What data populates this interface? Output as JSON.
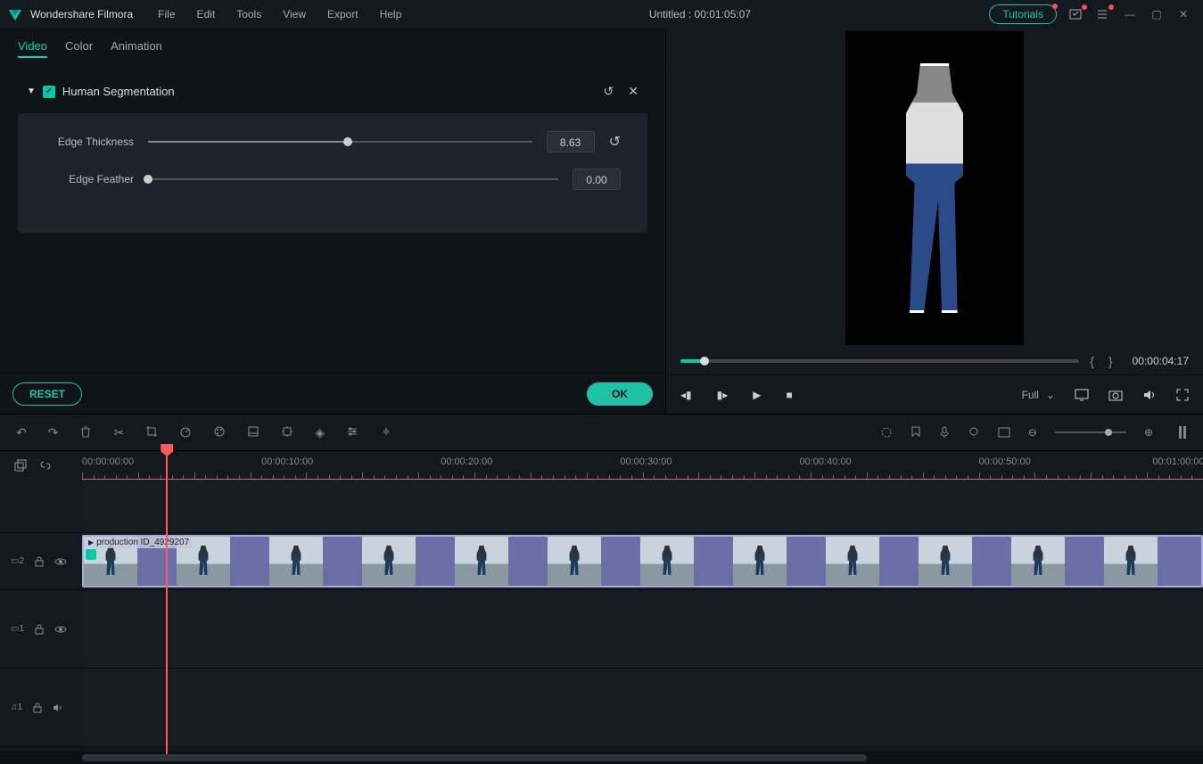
{
  "app": {
    "name": "Wondershare Filmora",
    "project_title": "Untitled : 00:01:05:07"
  },
  "menu": [
    "File",
    "Edit",
    "Tools",
    "View",
    "Export",
    "Help"
  ],
  "title_buttons": {
    "tutorials": "Tutorials"
  },
  "tabs": [
    "Video",
    "Color",
    "Animation"
  ],
  "section": {
    "title": "Human Segmentation",
    "checked": true
  },
  "params": {
    "thickness": {
      "label": "Edge Thickness",
      "value": "8.63",
      "percent": 52
    },
    "feather": {
      "label": "Edge Feather",
      "value": "0.00",
      "percent": 0
    }
  },
  "buttons": {
    "reset": "RESET",
    "ok": "OK"
  },
  "preview": {
    "time": "00:00:04:17",
    "progress_percent": 6,
    "quality": "Full"
  },
  "timeline": {
    "start": "00:00:00:00",
    "marks": [
      {
        "t": "00:00:00:00",
        "pct": 0
      },
      {
        "t": "00:00:10:00",
        "pct": 16
      },
      {
        "t": "00:00:20:00",
        "pct": 32
      },
      {
        "t": "00:00:30:00",
        "pct": 48
      },
      {
        "t": "00:00:40:00",
        "pct": 64
      },
      {
        "t": "00:00:50:00",
        "pct": 80
      },
      {
        "t": "00:01:00:00",
        "pct": 95.5
      }
    ],
    "playhead_pct": 7.5,
    "clip_name": "production ID_4929207",
    "tracks": [
      {
        "id": "v2",
        "icon": "video",
        "num": "2"
      },
      {
        "id": "v1",
        "icon": "video",
        "num": "1"
      },
      {
        "id": "a1",
        "icon": "audio",
        "num": "1"
      }
    ]
  }
}
